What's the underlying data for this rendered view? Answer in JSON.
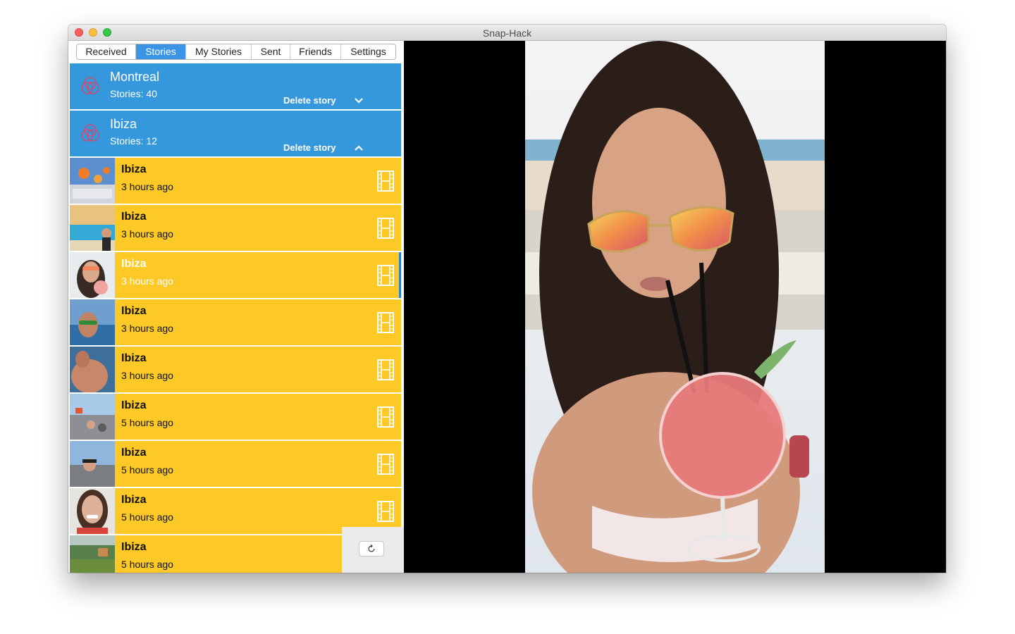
{
  "window": {
    "title": "Snap-Hack"
  },
  "tabs": [
    {
      "label": "Received"
    },
    {
      "label": "Stories",
      "active": true
    },
    {
      "label": "My Stories"
    },
    {
      "label": "Sent"
    },
    {
      "label": "Friends"
    },
    {
      "label": "Settings"
    }
  ],
  "groups": [
    {
      "name": "Montreal",
      "count": "Stories: 40",
      "delete_label": "Delete story",
      "expanded": false
    },
    {
      "name": "Ibiza",
      "count": "Stories: 12",
      "delete_label": "Delete story",
      "expanded": true
    }
  ],
  "items": [
    {
      "name": "Ibiza",
      "time": "3 hours ago"
    },
    {
      "name": "Ibiza",
      "time": "3 hours ago"
    },
    {
      "name": "Ibiza",
      "time": "3 hours ago",
      "selected": true
    },
    {
      "name": "Ibiza",
      "time": "3 hours ago"
    },
    {
      "name": "Ibiza",
      "time": "3 hours ago"
    },
    {
      "name": "Ibiza",
      "time": "5 hours ago"
    },
    {
      "name": "Ibiza",
      "time": "5 hours ago"
    },
    {
      "name": "Ibiza",
      "time": "5 hours ago"
    },
    {
      "name": "Ibiza",
      "time": "5 hours ago"
    }
  ],
  "icons": {
    "group": "snapchat-ghost-icon",
    "item": "film-strip-icon",
    "refresh": "refresh-icon"
  },
  "colors": {
    "group_bg": "#3598dc",
    "item_bg": "#fcc927",
    "active_tab": "#3b95e6",
    "viewer_bg": "#000000"
  }
}
